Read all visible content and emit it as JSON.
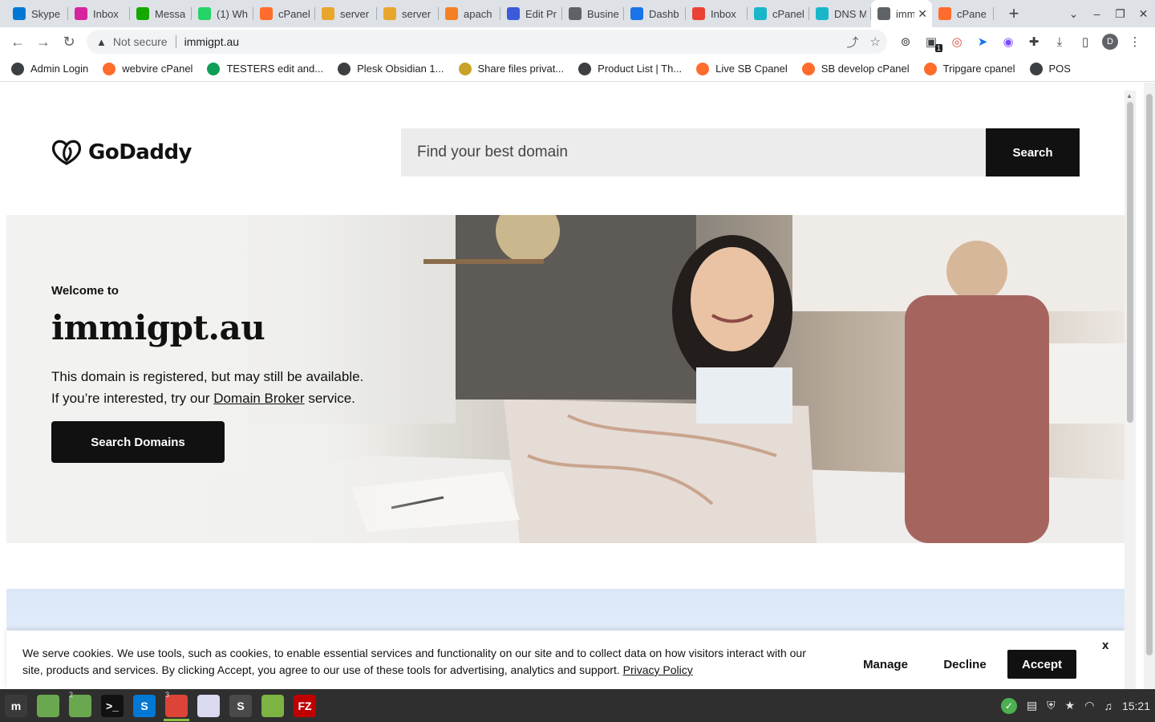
{
  "browser": {
    "tabs": [
      {
        "label": "Skype",
        "icon": "skype-icon",
        "color": "#0078d4"
      },
      {
        "label": "Inbox",
        "icon": "instagram-icon",
        "color": "#d6249f"
      },
      {
        "label": "Messa",
        "icon": "upwork-icon",
        "color": "#14a800"
      },
      {
        "label": "(1) Wh",
        "icon": "whatsapp-icon",
        "color": "#25d366"
      },
      {
        "label": "cPanel",
        "icon": "cpanel-icon",
        "color": "#ff6c2c"
      },
      {
        "label": "server",
        "icon": "phpmyadmin-icon",
        "color": "#e8a72c"
      },
      {
        "label": "server",
        "icon": "phpmyadmin-icon",
        "color": "#e8a72c"
      },
      {
        "label": "apach",
        "icon": "stackoverflow-icon",
        "color": "#f48024"
      },
      {
        "label": "Edit Pr",
        "icon": "edit-icon",
        "color": "#3b5bdb"
      },
      {
        "label": "Busine",
        "icon": "globe-icon",
        "color": "#5f6368"
      },
      {
        "label": "Dashb",
        "icon": "earth-icon",
        "color": "#1a73e8"
      },
      {
        "label": "Inbox",
        "icon": "gmail-icon",
        "color": "#ea4335"
      },
      {
        "label": "cPanel",
        "icon": "swirl-icon",
        "color": "#19b6c9"
      },
      {
        "label": "DNS M",
        "icon": "swirl-icon",
        "color": "#19b6c9"
      },
      {
        "label": "imm",
        "icon": "globe-icon",
        "color": "#5f6368",
        "active": true
      },
      {
        "label": "cPane",
        "icon": "cpanel-icon",
        "color": "#ff6c2c"
      }
    ],
    "new_tab_symbol": "+",
    "address": {
      "security_label": "Not secure",
      "url": "immigpt.au"
    },
    "profile_initial": "D",
    "extension_badge": "1"
  },
  "bookmarks": [
    {
      "label": "Admin Login",
      "icon": "globe-icon",
      "color": "#3c4043"
    },
    {
      "label": "webvire cPanel",
      "icon": "cpanel-icon",
      "color": "#ff6c2c"
    },
    {
      "label": "TESTERS edit and...",
      "icon": "sheets-icon",
      "color": "#0f9d58"
    },
    {
      "label": "Plesk Obsidian 1...",
      "icon": "plesk-icon",
      "color": "#3c4043"
    },
    {
      "label": "Share files privat...",
      "icon": "share-files-icon",
      "color": "#c9a227"
    },
    {
      "label": "Product List | Th...",
      "icon": "globe-icon",
      "color": "#3c4043"
    },
    {
      "label": "Live SB Cpanel",
      "icon": "cpanel-icon",
      "color": "#ff6c2c"
    },
    {
      "label": "SB develop cPanel",
      "icon": "cpanel-icon",
      "color": "#ff6c2c"
    },
    {
      "label": "Tripgare cpanel",
      "icon": "cpanel-icon",
      "color": "#ff6c2c"
    },
    {
      "label": "POS",
      "icon": "globe-icon",
      "color": "#3c4043"
    }
  ],
  "page": {
    "brand": "GoDaddy",
    "search": {
      "placeholder": "Find your best domain",
      "button_label": "Search"
    },
    "hero": {
      "welcome": "Welcome to",
      "domain": "immigpt.au",
      "message_line1": "This domain is registered, but may still be available.",
      "message_line2_before": "If you’re interested, try our",
      "message_link": "Domain Broker",
      "message_line2_after": "service.",
      "cta_label": "Search Domains"
    },
    "cookie_banner": {
      "text": "We serve cookies. We use tools, such as cookies, to enable essential services and functionality on our site and to collect data on how visitors interact with our site, products and services. By clicking Accept, you agree to our use of these tools for advertising, analytics and support.",
      "policy_link": "Privacy Policy",
      "manage_label": "Manage",
      "decline_label": "Decline",
      "accept_label": "Accept",
      "close_label": "x"
    }
  },
  "taskbar": {
    "apps": [
      {
        "name": "mint-menu-icon",
        "symbol": "m",
        "color": "#3a3a3a"
      },
      {
        "name": "files-icon",
        "symbol": "",
        "color": "#6aa84f"
      },
      {
        "name": "files-icon",
        "symbol": "",
        "color": "#6aa84f",
        "count": "2"
      },
      {
        "name": "terminal-icon",
        "symbol": ">_",
        "color": "#111111"
      },
      {
        "name": "skype-icon",
        "symbol": "S",
        "color": "#0078d4"
      },
      {
        "name": "chrome-icon",
        "symbol": "",
        "color": "#db4437",
        "count": "3",
        "active": true
      },
      {
        "name": "text-editor-icon",
        "symbol": "",
        "color": "#d9d9f0"
      },
      {
        "name": "sublime-icon",
        "symbol": "S",
        "color": "#4a4a4a"
      },
      {
        "name": "image-viewer-icon",
        "symbol": "",
        "color": "#7cb342"
      },
      {
        "name": "filezilla-icon",
        "symbol": "FZ",
        "color": "#bf0000"
      }
    ],
    "clock": "15:21"
  }
}
